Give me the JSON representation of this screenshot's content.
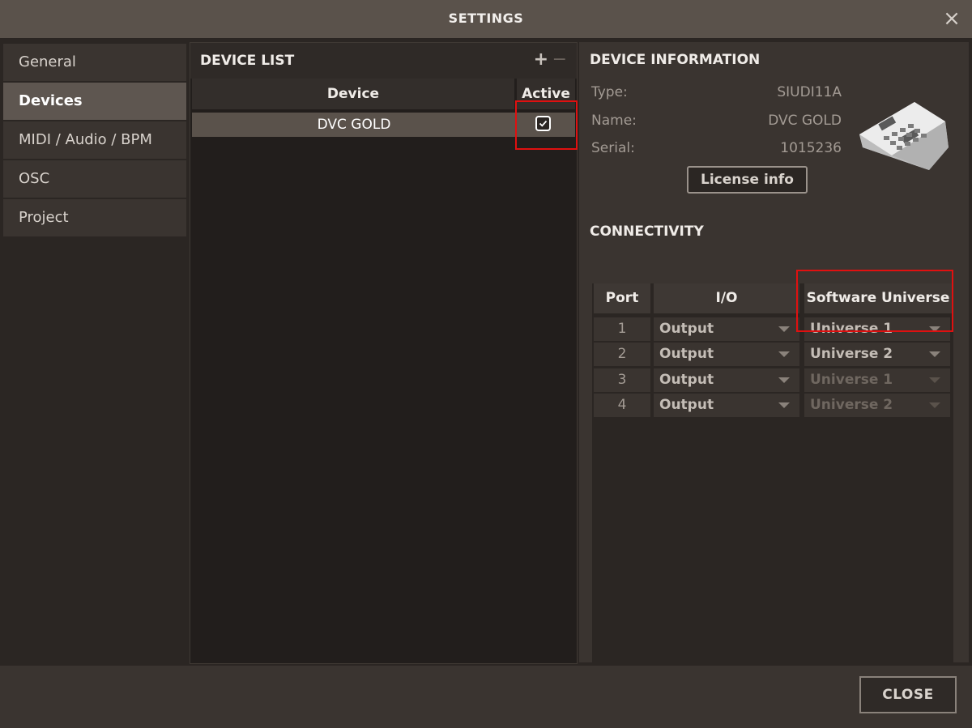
{
  "window": {
    "title": "SETTINGS",
    "close_glyph": "×"
  },
  "sidebar": {
    "items": [
      {
        "label": "General"
      },
      {
        "label": "Devices",
        "active": true
      },
      {
        "label": "MIDI / Audio / BPM"
      },
      {
        "label": "OSC"
      },
      {
        "label": "Project"
      }
    ]
  },
  "device_list": {
    "title": "DEVICE LIST",
    "add_label": "+",
    "remove_label": "−",
    "columns": {
      "device": "Device",
      "active": "Active"
    },
    "rows": [
      {
        "device": "DVC GOLD",
        "active": true
      }
    ]
  },
  "device_info": {
    "title": "DEVICE INFORMATION",
    "type_label": "Type:",
    "type_value": "SIUDI11A",
    "name_label": "Name:",
    "name_value": "DVC GOLD",
    "serial_label": "Serial:",
    "serial_value": "1015236",
    "license_button": "License info"
  },
  "connectivity": {
    "title": "CONNECTIVITY",
    "columns": {
      "port": "Port",
      "io": "I/O",
      "universe": "Software Universe"
    },
    "rows": [
      {
        "port": "1",
        "io": "Output",
        "universe": "Universe 1",
        "enabled": true
      },
      {
        "port": "2",
        "io": "Output",
        "universe": "Universe 2",
        "enabled": true
      },
      {
        "port": "3",
        "io": "Output",
        "universe": "Universe 1",
        "enabled": false
      },
      {
        "port": "4",
        "io": "Output",
        "universe": "Universe 2",
        "enabled": false
      }
    ]
  },
  "footer": {
    "close_label": "CLOSE"
  },
  "colors": {
    "highlight": "#e01010",
    "active_tab": "#5e5650",
    "background": "#2b2623"
  }
}
